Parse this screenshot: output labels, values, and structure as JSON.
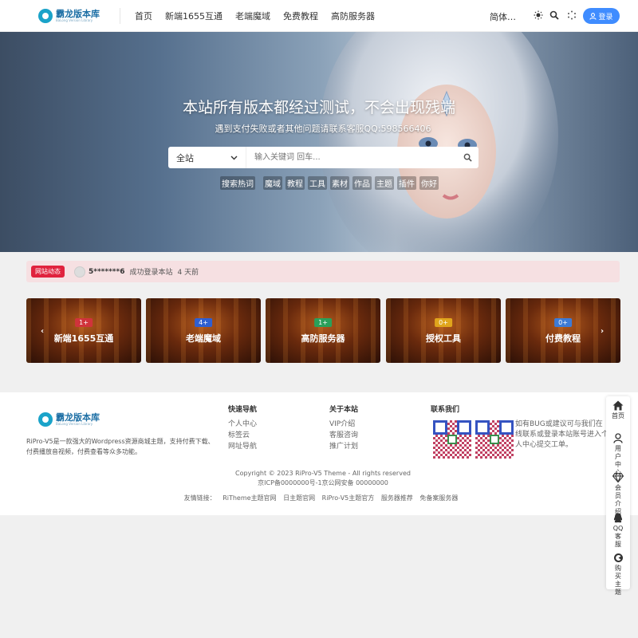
{
  "header": {
    "logo": {
      "cn": "霸龙版本库",
      "en": "BaLong Version Library"
    },
    "nav": [
      "首页",
      "新端1655互通",
      "老端魔域",
      "免费教程",
      "高防服务器"
    ],
    "lang": "简体…",
    "login_label": "登录"
  },
  "hero": {
    "title": "本站所有版本都经过测试，不会出现残端",
    "subtitle": "遇到支付失败或者其他问题请联系客服QQ:598566406",
    "search": {
      "scope": "全站",
      "placeholder": "输入关键词 回车..."
    },
    "hot_label": "搜索热词",
    "hot_words": [
      "魔域",
      "教程",
      "工具",
      "素材",
      "作品",
      "主题",
      "插件",
      "你好"
    ]
  },
  "ticker": {
    "badge": "网站动态",
    "user": "5*******6",
    "action": "成功登录本站",
    "time": "4 天前"
  },
  "categories": [
    {
      "count": "1+",
      "title": "新端1655互通",
      "badge_color": "#d0333b"
    },
    {
      "count": "4+",
      "title": "老端魔域",
      "badge_color": "#2f5fd1"
    },
    {
      "count": "1+",
      "title": "高防服务器",
      "badge_color": "#2aa05a"
    },
    {
      "count": "0+",
      "title": "授权工具",
      "badge_color": "#e0a51c"
    },
    {
      "count": "0+",
      "title": "付费教程",
      "badge_color": "#3d7bd6"
    }
  ],
  "footer": {
    "desc": "RiPro-V5是一款强大的Wordpress资源商城主题，支持付费下载、付费播放音视频，付费查看等众多功能。",
    "quick_nav": {
      "title": "快速导航",
      "items": [
        "个人中心",
        "标签云",
        "网址导航"
      ]
    },
    "about": {
      "title": "关于本站",
      "items": [
        "VIP介绍",
        "客服咨询",
        "推广计划"
      ]
    },
    "contact": {
      "title": "联系我们",
      "text": "如有BUG或建议可与我们在线联系或登录本站账号进入个人中心提交工单。"
    },
    "copyright": "Copyright © 2023 RiPro-V5 Theme - All rights reserved",
    "icp": "京ICP备0000000号-1京公网安备 00000000",
    "friends_label": "友情链接：",
    "friends": [
      "RiTheme主题官网",
      "日主题官网",
      "RiPro-V5主题官方",
      "服务器推荐",
      "免备案服务器"
    ]
  },
  "side_menu": [
    {
      "label": "首页",
      "icon": "home-icon"
    },
    {
      "label": "用户中心",
      "icon": "user-icon"
    },
    {
      "label": "会员介绍",
      "icon": "diamond-icon"
    },
    {
      "label": "QQ客服",
      "icon": "qq-icon"
    },
    {
      "label": "购买主题",
      "icon": "theme-icon"
    }
  ],
  "colors": {
    "accent": "#3f8cff",
    "ticker_badge": "#e0233e",
    "ticker_bg": "#f6e0e2"
  }
}
